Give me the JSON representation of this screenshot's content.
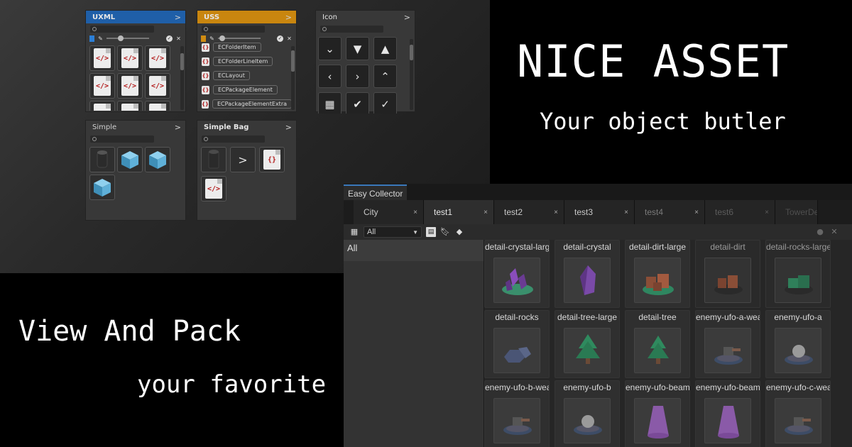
{
  "windows": {
    "uxml": {
      "title": "UXML",
      "chevron": ">",
      "close": "✕",
      "code": "</>"
    },
    "uss": {
      "title": "USS",
      "chevron": ">",
      "close": "✕",
      "items": [
        "ECFolderItem",
        "ECFolderLineItem",
        "ECLayout",
        "ECPackageElement",
        "ECPackageElementExtra"
      ]
    },
    "icon": {
      "title": "Icon",
      "chevron": ">",
      "glyphs": [
        "⌄",
        "▼",
        "▲",
        "‹",
        "›",
        "⌃",
        "▦",
        "✔",
        "✓"
      ]
    },
    "simple": {
      "title": "Simple",
      "chevron": ">"
    },
    "simple_bag": {
      "title": "Simple Bag",
      "chevron": ">",
      "arrow": ">",
      "braces": "{}",
      "code": "</>"
    }
  },
  "colors": {
    "uxml_header": "#1f5fa8",
    "uss_header": "#c9860f",
    "tab_accent": "#3a79bb"
  },
  "headline": {
    "title": "NICE ASSET",
    "subtitle": "Your object butler",
    "left_line1": "View And Pack",
    "left_line2": "your favorite"
  },
  "collector": {
    "window_title": "Easy Collector",
    "tabs": [
      {
        "label": "City",
        "close": "×"
      },
      {
        "label": "test1",
        "close": "×"
      },
      {
        "label": "test2",
        "close": "×"
      },
      {
        "label": "test3",
        "close": "×"
      },
      {
        "label": "test4",
        "close": "×"
      },
      {
        "label": "test6",
        "close": "×"
      },
      {
        "label": "TowerDe",
        "close": ""
      }
    ],
    "filter_value": "All",
    "sidebar_items": [
      "All"
    ],
    "assets": [
      [
        "detail-crystal-large",
        "detail-crystal",
        "detail-dirt-large",
        "detail-dirt",
        "detail-rocks-large"
      ],
      [
        "detail-rocks",
        "detail-tree-large",
        "detail-tree",
        "enemy-ufo-a-weapon",
        "enemy-ufo-a"
      ],
      [
        "enemy-ufo-b-weapon",
        "enemy-ufo-b",
        "enemy-ufo-beam-b",
        "enemy-ufo-beam",
        "enemy-ufo-c-weapon"
      ]
    ]
  }
}
